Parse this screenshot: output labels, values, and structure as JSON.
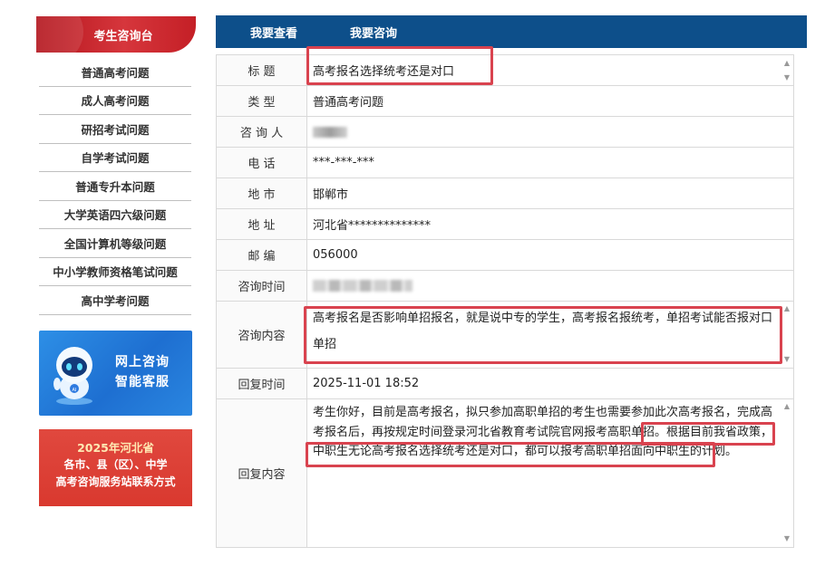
{
  "sidebar": {
    "header": "考生咨询台",
    "items": [
      {
        "label": "普通高考问题"
      },
      {
        "label": "成人高考问题"
      },
      {
        "label": "研招考试问题"
      },
      {
        "label": "自学考试问题"
      },
      {
        "label": "普通专升本问题"
      },
      {
        "label": "大学英语四六级问题"
      },
      {
        "label": "全国计算机等级问题"
      },
      {
        "label": "中小学教师资格笔试问题"
      },
      {
        "label": "高中学考问题"
      }
    ],
    "ai_banner": {
      "line1": "网上咨询",
      "line2": "智能客服"
    },
    "red_banner": {
      "line1": "2025年河北省",
      "line2": "各市、县（区）、中学",
      "line3": "高考咨询服务站联系方式"
    }
  },
  "tabs": {
    "view": "我要查看",
    "ask": "我要咨询"
  },
  "form": {
    "title_label": "标  题",
    "title_value": "高考报名选择统考还是对口",
    "type_label": "类  型",
    "type_value": "普通高考问题",
    "asker_label": "咨 询 人",
    "phone_label": "电  话",
    "phone_value": "***-***-***",
    "city_label": "地  市",
    "city_value": "邯郸市",
    "address_label": "地  址",
    "address_value": "河北省**************",
    "postcode_label": "邮  编",
    "postcode_value": "056000",
    "consult_time_label": "咨询时间",
    "content_label": "咨询内容",
    "content_value": "高考报名是否影响单招报名，就是说中专的学生，高考报名报统考，单招考试能否报对口单招",
    "reply_time_label": "回复时间",
    "reply_time_value": "2025-11-01 18:52",
    "reply_label": "回复内容",
    "reply_value": "考生你好，目前是高考报名，拟只参加高职单招的考生也需要参加此次高考报名，完成高考报名后，再按规定时间登录河北省教育考试院官网报考高职单招。根据目前我省政策，中职生无论高考报名选择统考还是对口，都可以报考高职单招面向中职生的计划。"
  },
  "colors": {
    "nav_blue": "#0d4f8a",
    "header_red": "#c41f26",
    "highlight_red": "#d9434f",
    "ai_blue": "#1e6fd1"
  }
}
